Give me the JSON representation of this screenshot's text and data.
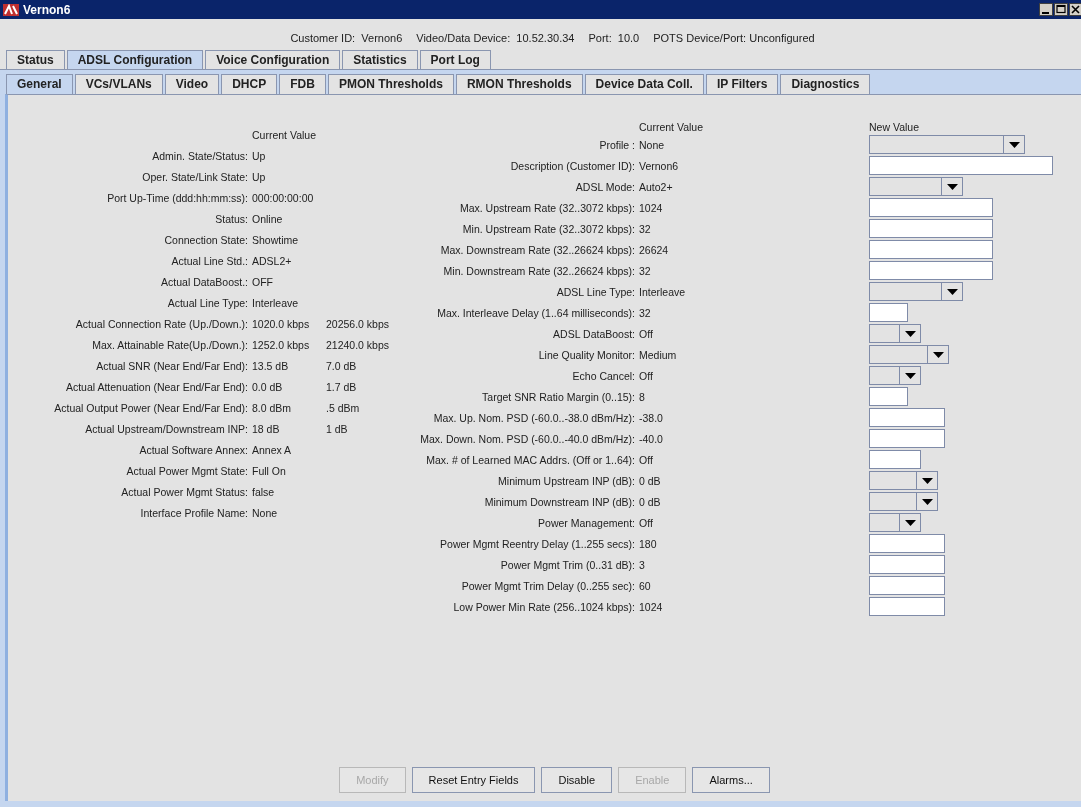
{
  "window": {
    "title": "Vernon6"
  },
  "info_line": [
    "Customer ID:  Vernon6",
    "Video/Data Device:  10.52.30.34",
    "Port:  10.0",
    "POTS Device/Port: Unconfigured"
  ],
  "tabs": [
    {
      "label": "Status",
      "selected": false
    },
    {
      "label": "ADSL Configuration",
      "selected": true
    },
    {
      "label": "Voice Configuration",
      "selected": false
    },
    {
      "label": "Statistics",
      "selected": false
    },
    {
      "label": "Port Log",
      "selected": false
    }
  ],
  "sub_tabs": [
    {
      "label": "General",
      "selected": true
    },
    {
      "label": "VCs/VLANs",
      "selected": false
    },
    {
      "label": "Video",
      "selected": false
    },
    {
      "label": "DHCP",
      "selected": false
    },
    {
      "label": "FDB",
      "selected": false
    },
    {
      "label": "PMON Thresholds",
      "selected": false
    },
    {
      "label": "RMON Thresholds",
      "selected": false
    },
    {
      "label": "Device Data Coll.",
      "selected": false
    },
    {
      "label": "IP Filters",
      "selected": false
    },
    {
      "label": "Diagnostics",
      "selected": false
    }
  ],
  "status_panel": {
    "header": "Current Value",
    "rows": [
      {
        "label": "Admin. State/Status:",
        "value": "Up"
      },
      {
        "label": "Oper. State/Link State:",
        "value": "Up"
      },
      {
        "label": "Port Up-Time (ddd:hh:mm:ss):",
        "value": "000:00:00:00"
      },
      {
        "label": "Status:",
        "value": "Online"
      },
      {
        "label": "Connection State:",
        "value": "Showtime"
      },
      {
        "label": "Actual Line Std.:",
        "value": "ADSL2+"
      },
      {
        "label": "Actual DataBoost.:",
        "value": "OFF"
      },
      {
        "label": "Actual Line Type:",
        "value": "Interleave"
      },
      {
        "label": "Actual Connection Rate (Up./Down.):",
        "value": "1020.0 kbps",
        "value_2": "20256.0 kbps"
      },
      {
        "label": "Max. Attainable Rate(Up./Down.):",
        "value": "1252.0 kbps",
        "value_2": "21240.0 kbps"
      },
      {
        "label": "Actual SNR (Near End/Far End):",
        "value": "13.5 dB",
        "value_2": "7.0 dB"
      },
      {
        "label": "Actual Attenuation (Near End/Far End):",
        "value": "0.0 dB",
        "value_2": "1.7 dB"
      },
      {
        "label": "Actual Output Power (Near End/Far End):",
        "value": "8.0 dBm",
        "value_2": ".5 dBm"
      },
      {
        "label": "Actual Upstream/Downstream INP:",
        "value": "18 dB",
        "value_2": "1 dB"
      },
      {
        "label": "Actual Software Annex:",
        "value": "Annex A"
      },
      {
        "label": "Actual Power Mgmt State:",
        "value": "Full On"
      },
      {
        "label": "Actual Power Mgmt Status:",
        "value": "false"
      },
      {
        "label": "Interface Profile Name:",
        "value": "None"
      }
    ]
  },
  "config_panel": {
    "current_header": "Current Value",
    "new_header": "New Value",
    "rows": [
      {
        "label": "Profile :",
        "value": "None",
        "kind": "widecombo"
      },
      {
        "label": "Description (Customer ID):",
        "value": "Vernon6",
        "kind": "widefield"
      },
      {
        "label": "ADSL Mode:",
        "value": "Auto2+",
        "kind": "combo"
      },
      {
        "label": "Max. Upstream Rate (32..3072 kbps):",
        "value": "1024",
        "kind": "field"
      },
      {
        "label": "Min. Upstream Rate (32..3072 kbps):",
        "value": "32",
        "kind": "field"
      },
      {
        "label": "Max. Downstream Rate (32..26624 kbps):",
        "value": "26624",
        "kind": "field"
      },
      {
        "label": "Min. Downstream Rate (32..26624 kbps):",
        "value": "32",
        "kind": "field"
      },
      {
        "label": "ADSL Line Type:",
        "value": "Interleave",
        "kind": "combo"
      },
      {
        "label": "Max. Interleave Delay (1..64 milliseconds):",
        "value": "32",
        "kind": "tinyfield"
      },
      {
        "label": "ADSL DataBoost:",
        "value": "Off",
        "kind": "tinycombo"
      },
      {
        "label": "Line Quality Monitor:",
        "value": "Medium",
        "kind": "mediumcombo"
      },
      {
        "label": "Echo Cancel:",
        "value": "Off",
        "kind": "tinycombo"
      },
      {
        "label": "Target SNR Ratio Margin (0..15):",
        "value": "8",
        "kind": "tinyfield"
      },
      {
        "label": "Max. Up. Nom. PSD (-60.0..-38.0 dBm/Hz):",
        "value": "-38.0",
        "kind": "mediumfield"
      },
      {
        "label": "Max. Down. Nom. PSD (-60.0..-40.0 dBm/Hz):",
        "value": "-40.0",
        "kind": "mediumfield"
      },
      {
        "label": "Max. # of Learned MAC Addrs. (Off or 1..64):",
        "value": "Off",
        "kind": "smallfield"
      },
      {
        "label": "Minimum Upstream INP (dB):",
        "value": "0 dB",
        "kind": "smallcombo"
      },
      {
        "label": "Minimum Downstream INP (dB):",
        "value": "0 dB",
        "kind": "smallcombo"
      },
      {
        "label": "Power Management:",
        "value": "Off",
        "kind": "tinycombo"
      },
      {
        "label": "Power Mgmt Reentry Delay (1..255 secs):",
        "value": "180",
        "kind": "mediumfield"
      },
      {
        "label": "Power Mgmt Trim (0..31 dB):",
        "value": "3",
        "kind": "mediumfield"
      },
      {
        "label": "Power Mgmt Trim Delay (0..255 sec):",
        "value": "60",
        "kind": "mediumfield"
      },
      {
        "label": "Low Power Min Rate (256..1024 kbps):",
        "value": "1024",
        "kind": "mediumfield"
      }
    ]
  },
  "buttons": [
    {
      "label": "Modify",
      "disabled": true
    },
    {
      "label": "Reset Entry Fields",
      "disabled": false
    },
    {
      "label": "Disable",
      "disabled": false
    },
    {
      "label": "Enable",
      "disabled": true
    },
    {
      "label": "Alarms...",
      "disabled": false
    }
  ]
}
